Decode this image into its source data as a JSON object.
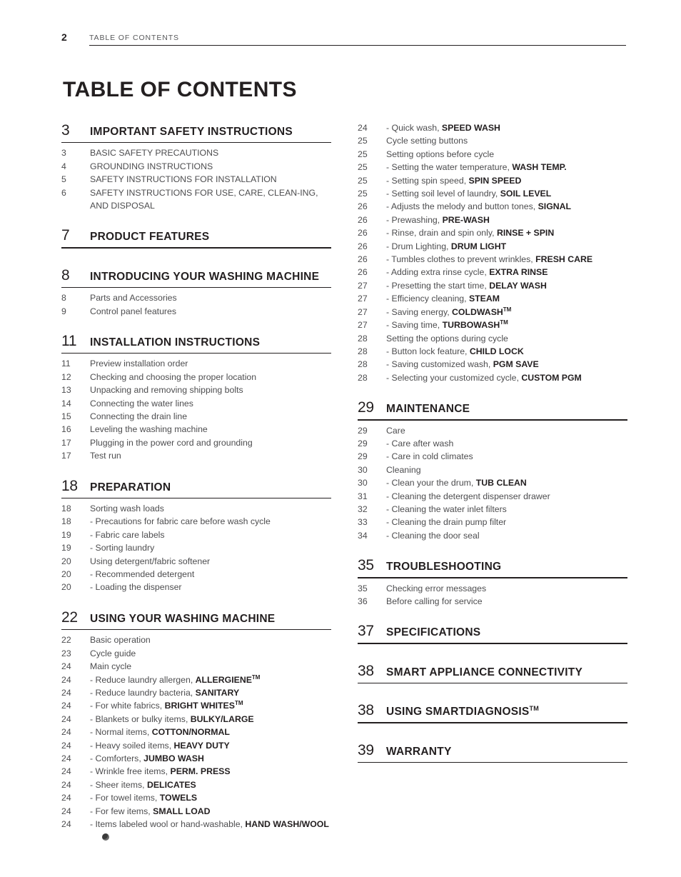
{
  "header": {
    "page_number": "2",
    "label": "TABLE OF CONTENTS"
  },
  "title": "TABLE OF CONTENTS",
  "columns": {
    "left": [
      {
        "type": "section",
        "number": "3",
        "title": "IMPORTANT SAFETY INSTRUCTIONS",
        "entries": [
          {
            "num": "3",
            "text": "BASIC SAFETY PRECAUTIONS",
            "sub": false
          },
          {
            "num": "4",
            "text": "GROUNDING INSTRUCTIONS",
            "sub": false
          },
          {
            "num": "5",
            "text": "SAFETY INSTRUCTIONS FOR INSTALLATION",
            "sub": false
          },
          {
            "num": "6",
            "text": "SAFETY INSTRUCTIONS FOR USE, CARE, CLEAN-ING, AND DISPOSAL",
            "sub": false
          }
        ]
      },
      {
        "type": "section",
        "number": "7",
        "title": "PRODUCT FEATURES",
        "entries": []
      },
      {
        "type": "section",
        "number": "8",
        "title": "INTRODUCING YOUR WASHING MACHINE",
        "entries": [
          {
            "num": "8",
            "text": "Parts and Accessories",
            "sub": false
          },
          {
            "num": "9",
            "text": "Control panel features",
            "sub": false
          }
        ]
      },
      {
        "type": "section",
        "number": "11",
        "title": "INSTALLATION INSTRUCTIONS",
        "entries": [
          {
            "num": "11",
            "text": "Preview installation order",
            "sub": false
          },
          {
            "num": "12",
            "text": "Checking and choosing the proper location",
            "sub": false
          },
          {
            "num": "13",
            "text": "Unpacking and removing shipping bolts",
            "sub": false
          },
          {
            "num": "14",
            "text": "Connecting the water lines",
            "sub": false
          },
          {
            "num": "15",
            "text": "Connecting the drain line",
            "sub": false
          },
          {
            "num": "16",
            "text": "Leveling the washing machine",
            "sub": false
          },
          {
            "num": "17",
            "text": "Plugging in the power cord and grounding",
            "sub": false
          },
          {
            "num": "17",
            "text": "Test run",
            "sub": false
          }
        ]
      },
      {
        "type": "section",
        "number": "18",
        "title": "PREPARATION",
        "entries": [
          {
            "num": "18",
            "text": "Sorting wash loads",
            "sub": false
          },
          {
            "num": "18",
            "text": "- Precautions for fabric care before wash cycle",
            "sub": true
          },
          {
            "num": "19",
            "text": "- Fabric care labels",
            "sub": true
          },
          {
            "num": "19",
            "text": "- Sorting laundry",
            "sub": true
          },
          {
            "num": "20",
            "text": "Using detergent/fabric softener",
            "sub": false
          },
          {
            "num": "20",
            "text": "- Recommended detergent",
            "sub": true
          },
          {
            "num": "20",
            "text": "- Loading the dispenser",
            "sub": true
          }
        ]
      },
      {
        "type": "section",
        "number": "22",
        "title": "USING YOUR WASHING MACHINE",
        "entries": [
          {
            "num": "22",
            "text": "Basic operation",
            "sub": false
          },
          {
            "num": "23",
            "text": "Cycle guide",
            "sub": false
          },
          {
            "num": "24",
            "text": "Main cycle",
            "sub": false
          },
          {
            "num": "24",
            "text": "- Reduce laundry allergen, ",
            "bold": "ALLERGIENE",
            "trademark": true,
            "sub": true
          },
          {
            "num": "24",
            "text": "- Reduce laundry bacteria, ",
            "bold": "SANITARY",
            "sub": true
          },
          {
            "num": "24",
            "text": "- For white fabrics, ",
            "bold": "BRIGHT WHITES",
            "trademark": true,
            "sub": true
          },
          {
            "num": "24",
            "text": "- Blankets or bulky items, ",
            "bold": "BULKY/LARGE",
            "sub": true
          },
          {
            "num": "24",
            "text": "- Normal items, ",
            "bold": "COTTON/NORMAL",
            "sub": true
          },
          {
            "num": "24",
            "text": "- Heavy soiled items, ",
            "bold": "HEAVY DUTY",
            "sub": true
          },
          {
            "num": "24",
            "text": "- Comforters, ",
            "bold": "JUMBO WASH",
            "sub": true
          },
          {
            "num": "24",
            "text": "- Wrinkle free items, ",
            "bold": "PERM. PRESS",
            "sub": true
          },
          {
            "num": "24",
            "text": "- Sheer items, ",
            "bold": "DELICATES",
            "sub": true
          },
          {
            "num": "24",
            "text": "- For towel items, ",
            "bold": "TOWELS",
            "sub": true
          },
          {
            "num": "24",
            "text": "- For few items, ",
            "bold": "SMALL LOAD",
            "sub": true
          },
          {
            "num": "24",
            "text": "- Items labeled wool or hand-washable, ",
            "bold": "HAND WASH/WOOL",
            "wool": true,
            "sub": true
          }
        ]
      }
    ],
    "right": [
      {
        "type": "entries-only",
        "entries": [
          {
            "num": "24",
            "text": "- Quick wash, ",
            "bold": "SPEED WASH",
            "sub": true
          },
          {
            "num": "25",
            "text": "Cycle setting buttons",
            "sub": false
          },
          {
            "num": "25",
            "text": "Setting options before cycle",
            "sub": false
          },
          {
            "num": "25",
            "text": "- Setting the water temperature, ",
            "bold": "WASH TEMP.",
            "sub": true
          },
          {
            "num": "25",
            "text": "- Setting spin speed, ",
            "bold": "SPIN SPEED",
            "sub": true
          },
          {
            "num": "25",
            "text": "- Setting soil level of laundry, ",
            "bold": "SOIL LEVEL",
            "sub": true
          },
          {
            "num": "26",
            "text": "- Adjusts the melody and button tones, ",
            "bold": "SIGNAL",
            "sub": true
          },
          {
            "num": "26",
            "text": "- Prewashing, ",
            "bold": "PRE-WASH",
            "sub": true
          },
          {
            "num": "26",
            "text": "- Rinse, drain and spin only, ",
            "bold": "RINSE + SPIN",
            "sub": true
          },
          {
            "num": "26",
            "text": "- Drum Lighting, ",
            "bold": "DRUM LIGHT",
            "sub": true
          },
          {
            "num": "26",
            "text": "- Tumbles clothes to prevent wrinkles, ",
            "bold": "FRESH CARE",
            "sub": true
          },
          {
            "num": "26",
            "text": "- Adding extra rinse cycle, ",
            "bold": "EXTRA RINSE",
            "sub": true
          },
          {
            "num": "27",
            "text": "- Presetting the start time, ",
            "bold": "DELAY WASH",
            "sub": true
          },
          {
            "num": "27",
            "text": "- Efficiency cleaning, ",
            "bold": "STEAM",
            "sub": true
          },
          {
            "num": "27",
            "text": "- Saving energy, ",
            "bold": "COLDWASH",
            "trademark": true,
            "sub": true
          },
          {
            "num": "27",
            "text": "- Saving time, ",
            "bold": "TURBOWASH",
            "trademark": true,
            "sub": true
          },
          {
            "num": "28",
            "text": "Setting the options during cycle",
            "sub": false
          },
          {
            "num": "28",
            "text": "- Button lock feature, ",
            "bold": "CHILD LOCK",
            "sub": true
          },
          {
            "num": "28",
            "text": "- Saving customized wash, ",
            "bold": "PGM SAVE",
            "sub": true
          },
          {
            "num": "28",
            "text": "- Selecting your customized cycle, ",
            "bold": "CUSTOM PGM",
            "sub": true
          }
        ]
      },
      {
        "type": "section",
        "number": "29",
        "title": "MAINTENANCE",
        "entries": [
          {
            "num": "29",
            "text": "Care",
            "sub": false
          },
          {
            "num": "29",
            "text": "- Care after wash",
            "sub": true
          },
          {
            "num": "29",
            "text": "- Care in cold climates",
            "sub": true
          },
          {
            "num": "30",
            "text": "Cleaning",
            "sub": false
          },
          {
            "num": "30",
            "text": "- Clean your the drum, ",
            "bold": "TUB CLEAN",
            "sub": true
          },
          {
            "num": "31",
            "text": "- Cleaning the detergent dispenser drawer",
            "sub": true
          },
          {
            "num": "32",
            "text": "- Cleaning the water inlet filters",
            "sub": true
          },
          {
            "num": "33",
            "text": "- Cleaning the drain pump filter",
            "sub": true
          },
          {
            "num": "34",
            "text": "- Cleaning the door seal",
            "sub": true
          }
        ]
      },
      {
        "type": "section",
        "number": "35",
        "title": "TROUBLESHOOTING",
        "entries": [
          {
            "num": "35",
            "text": "Checking error messages",
            "sub": false
          },
          {
            "num": "36",
            "text": "Before calling for service",
            "sub": false
          }
        ]
      },
      {
        "type": "section",
        "number": "37",
        "title": "SPECIFICATIONS",
        "entries": []
      },
      {
        "type": "section",
        "number": "38",
        "title": "SMART APPLIANCE CONNECTIVITY",
        "entries": []
      },
      {
        "type": "section",
        "number": "38",
        "title": "USING SMARTDIAGNOSIS",
        "title_trademark": true,
        "entries": []
      },
      {
        "type": "section",
        "number": "39",
        "title": "WARRANTY",
        "entries": []
      }
    ]
  }
}
